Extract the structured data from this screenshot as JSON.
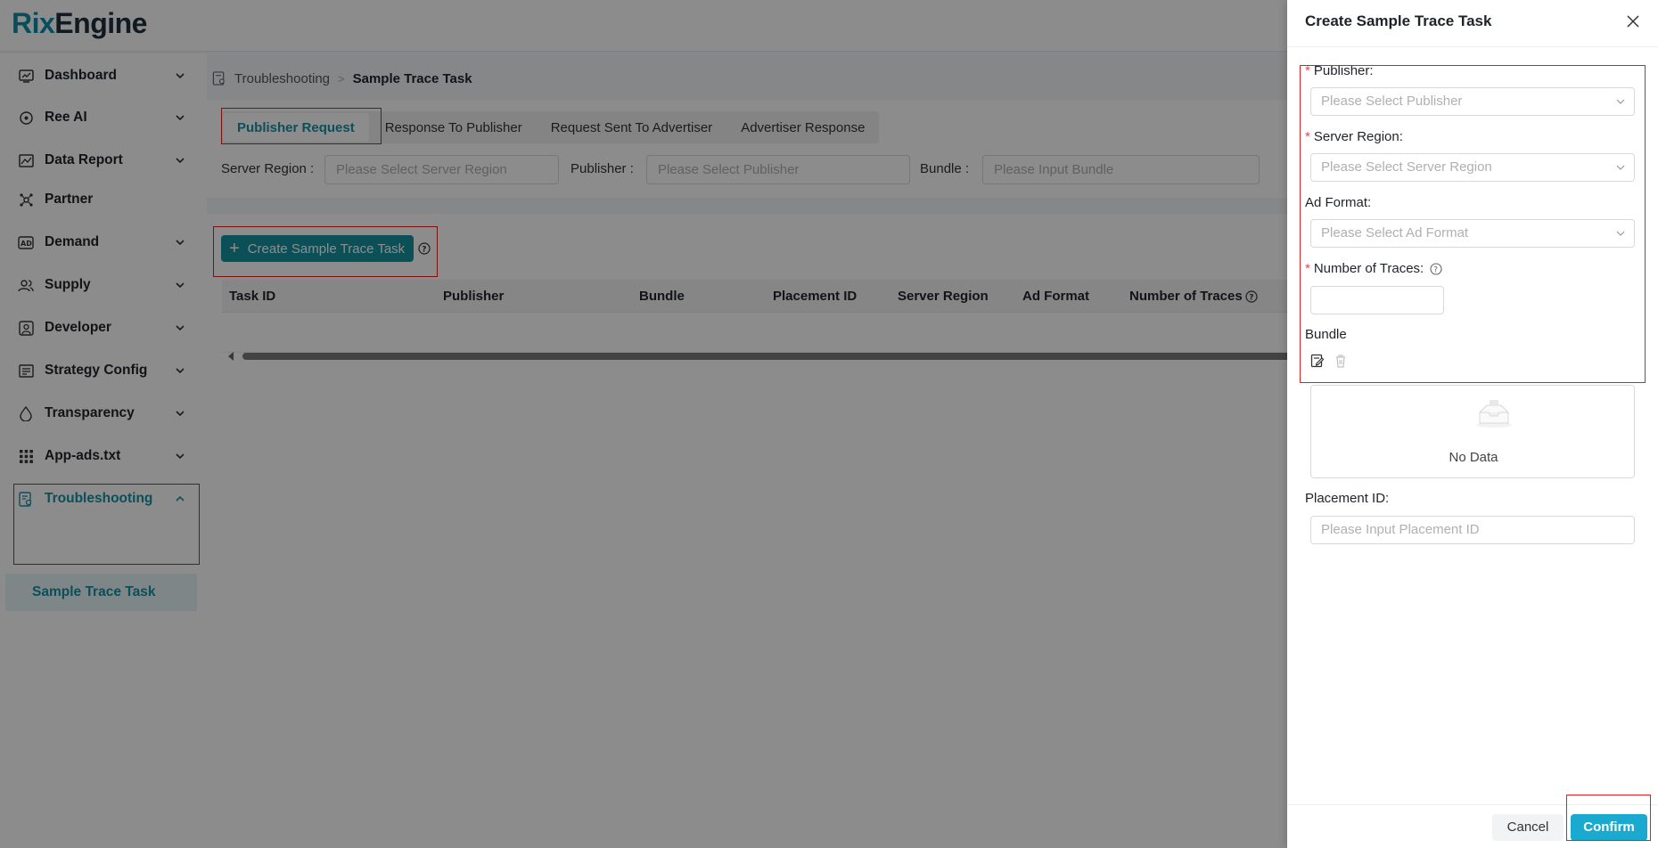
{
  "app": {
    "logo_part1": "Rix",
    "logo_part2": "Engine"
  },
  "sidebar": {
    "items": [
      {
        "label": "Dashboard",
        "icon": "dashboard-icon"
      },
      {
        "label": "Ree AI",
        "icon": "ai-icon"
      },
      {
        "label": "Data Report",
        "icon": "chart-icon"
      },
      {
        "label": "Partner",
        "icon": "partner-icon"
      },
      {
        "label": "Demand",
        "icon": "ad-icon"
      },
      {
        "label": "Supply",
        "icon": "users-icon"
      },
      {
        "label": "Developer",
        "icon": "developer-icon"
      },
      {
        "label": "Strategy Config",
        "icon": "strategy-icon"
      },
      {
        "label": "Transparency",
        "icon": "transparency-icon"
      },
      {
        "label": "App-ads.txt",
        "icon": "grid-icon"
      },
      {
        "label": "Troubleshooting",
        "icon": "troubleshooting-icon"
      }
    ],
    "sub_item": "Sample Trace Task"
  },
  "breadcrumb": {
    "parent": "Troubleshooting",
    "separator": ">",
    "current": "Sample Trace Task"
  },
  "tabs": [
    "Publisher Request",
    "Response To Publisher",
    "Request Sent To Advertiser",
    "Advertiser Response"
  ],
  "filters": {
    "server_region_label": "Server Region",
    "server_region_placeholder": "Please Select Server Region",
    "publisher_label": "Publisher",
    "publisher_placeholder": "Please Select Publisher",
    "bundle_label": "Bundle",
    "bundle_placeholder": "Please Input Bundle"
  },
  "toolbar": {
    "create_label": "Create Sample Trace Task"
  },
  "table": {
    "columns": [
      "Task ID",
      "Publisher",
      "Bundle",
      "Placement ID",
      "Server Region",
      "Ad Format",
      "Number of Traces"
    ]
  },
  "drawer": {
    "title": "Create Sample Trace Task",
    "publisher_label": "Publisher:",
    "publisher_placeholder": "Please Select Publisher",
    "server_region_label": "Server Region:",
    "server_region_placeholder": "Please Select Server Region",
    "ad_format_label": "Ad Format:",
    "ad_format_placeholder": "Please Select Ad Format",
    "traces_label": "Number of Traces:",
    "bundle_label": "Bundle",
    "no_data": "No Data",
    "placement_label": "Placement ID:",
    "placement_placeholder": "Please Input Placement ID",
    "cancel_label": "Cancel",
    "confirm_label": "Confirm",
    "required_mark": "*"
  },
  "colors": {
    "accent": "#16929f",
    "confirm": "#1aaad0",
    "required": "#e5484d",
    "annotation": "#e02020"
  }
}
